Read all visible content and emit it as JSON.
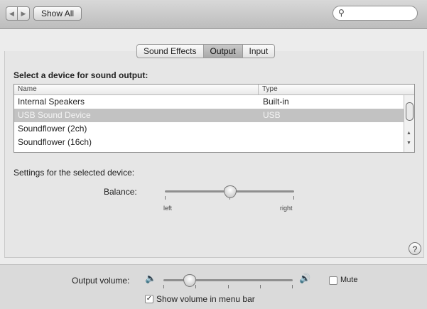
{
  "toolbar": {
    "back_icon": "back-arrow-icon",
    "forward_icon": "forward-arrow-icon",
    "show_all_label": "Show All",
    "search_placeholder": ""
  },
  "tabs": [
    {
      "label": "Sound Effects",
      "selected": false
    },
    {
      "label": "Output",
      "selected": true
    },
    {
      "label": "Input",
      "selected": false
    }
  ],
  "device_section": {
    "heading": "Select a device for sound output:",
    "columns": {
      "name": "Name",
      "type": "Type"
    },
    "rows": [
      {
        "name": "Internal Speakers",
        "type": "Built-in",
        "selected": false
      },
      {
        "name": "USB Sound Device",
        "type": "USB",
        "selected": true
      },
      {
        "name": "Soundflower (2ch)",
        "type": "",
        "selected": false
      },
      {
        "name": "Soundflower (16ch)",
        "type": "",
        "selected": false
      }
    ]
  },
  "settings_section": {
    "heading": "Settings for the selected device:",
    "balance_label": "Balance:",
    "balance_left_label": "left",
    "balance_right_label": "right",
    "balance_value": 0.5
  },
  "output": {
    "volume_label": "Output volume:",
    "volume_value": 0.2,
    "mute_label": "Mute",
    "mute_checked": false,
    "show_volume_label": "Show volume in menu bar",
    "show_volume_checked": true
  },
  "help": {
    "label": "?"
  },
  "colors": {
    "selected_row": "#c2c2c2",
    "background": "#ececec"
  }
}
